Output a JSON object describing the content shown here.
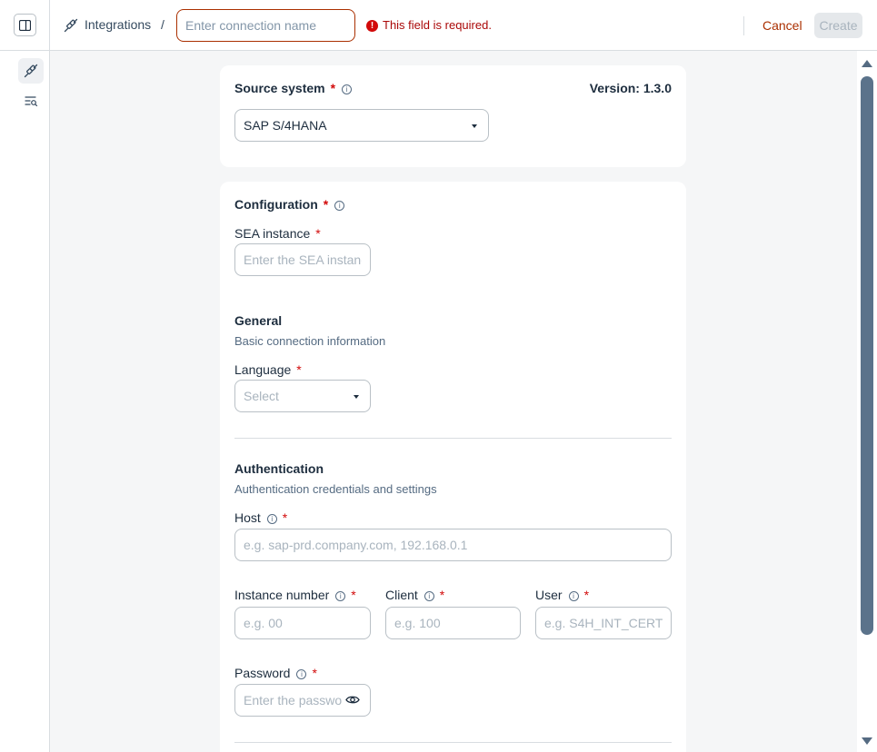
{
  "header": {
    "breadcrumb_link": "Integrations",
    "breadcrumb_separator": "/",
    "name_placeholder": "Enter connection name",
    "name_value": "",
    "error_text": "This field is required.",
    "cancel_label": "Cancel",
    "create_label": "Create"
  },
  "source": {
    "label": "Source system",
    "required_mark": "*",
    "version": "Version: 1.3.0",
    "selected": "SAP S/4HANA"
  },
  "config": {
    "title": "Configuration",
    "required_mark": "*",
    "sea_label": "SEA instance",
    "sea_placeholder": "Enter the SEA instance",
    "general": {
      "title": "General",
      "subtitle": "Basic connection information",
      "language_label": "Language",
      "language_value": "Select"
    },
    "auth": {
      "title": "Authentication",
      "subtitle": "Authentication credentials and settings",
      "host_label": "Host",
      "host_placeholder": "e.g. sap-prd.company.com, 192.168.0.1",
      "instance_label": "Instance number",
      "instance_placeholder": "e.g. 00",
      "client_label": "Client",
      "client_placeholder": "e.g. 100",
      "user_label": "User",
      "user_placeholder": "e.g. S4H_INT_CERT",
      "password_label": "Password",
      "password_placeholder": "Enter the password"
    }
  },
  "colors": {
    "accent": "#aa2f00",
    "error": "#d20a0a",
    "text": "#1d2d3e",
    "muted": "#556b82"
  },
  "icons": {
    "panel_toggle": "sidebar-panel-icon",
    "breadcrumb": "connection-plug-icon",
    "rail_primary": "connection-plug-icon",
    "rail_secondary": "list-search-icon",
    "error": "exclamation-circle-icon",
    "password_toggle": "eye-icon",
    "info": "info-icon"
  }
}
